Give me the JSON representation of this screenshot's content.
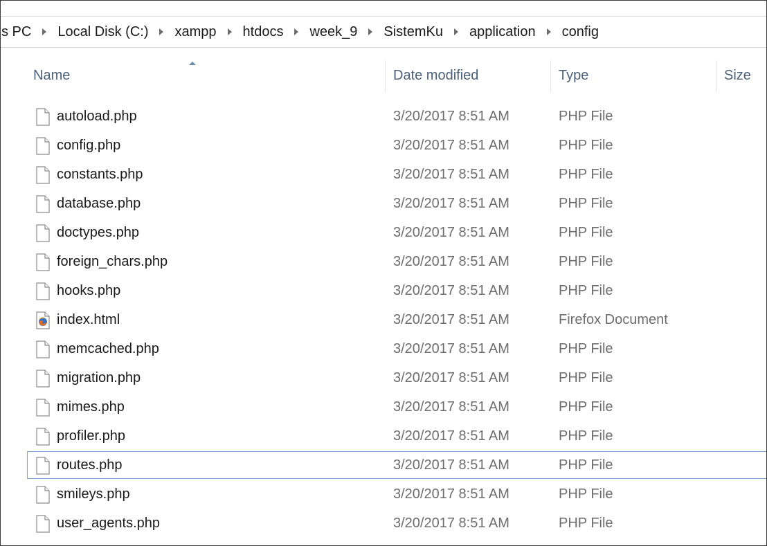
{
  "breadcrumb": [
    "s PC",
    "Local Disk (C:)",
    "xampp",
    "htdocs",
    "week_9",
    "SistemKu",
    "application",
    "config"
  ],
  "columns": {
    "name": "Name",
    "date_modified": "Date modified",
    "type": "Type",
    "size": "Size"
  },
  "files": [
    {
      "name": "autoload.php",
      "date": "3/20/2017 8:51 AM",
      "type": "PHP File",
      "icon": "blank-file-icon"
    },
    {
      "name": "config.php",
      "date": "3/20/2017 8:51 AM",
      "type": "PHP File",
      "icon": "blank-file-icon"
    },
    {
      "name": "constants.php",
      "date": "3/20/2017 8:51 AM",
      "type": "PHP File",
      "icon": "blank-file-icon"
    },
    {
      "name": "database.php",
      "date": "3/20/2017 8:51 AM",
      "type": "PHP File",
      "icon": "blank-file-icon"
    },
    {
      "name": "doctypes.php",
      "date": "3/20/2017 8:51 AM",
      "type": "PHP File",
      "icon": "blank-file-icon"
    },
    {
      "name": "foreign_chars.php",
      "date": "3/20/2017 8:51 AM",
      "type": "PHP File",
      "icon": "blank-file-icon"
    },
    {
      "name": "hooks.php",
      "date": "3/20/2017 8:51 AM",
      "type": "PHP File",
      "icon": "blank-file-icon"
    },
    {
      "name": "index.html",
      "date": "3/20/2017 8:51 AM",
      "type": "Firefox Document",
      "icon": "firefox-icon"
    },
    {
      "name": "memcached.php",
      "date": "3/20/2017 8:51 AM",
      "type": "PHP File",
      "icon": "blank-file-icon"
    },
    {
      "name": "migration.php",
      "date": "3/20/2017 8:51 AM",
      "type": "PHP File",
      "icon": "blank-file-icon"
    },
    {
      "name": "mimes.php",
      "date": "3/20/2017 8:51 AM",
      "type": "PHP File",
      "icon": "blank-file-icon"
    },
    {
      "name": "profiler.php",
      "date": "3/20/2017 8:51 AM",
      "type": "PHP File",
      "icon": "blank-file-icon"
    },
    {
      "name": "routes.php",
      "date": "3/20/2017 8:51 AM",
      "type": "PHP File",
      "icon": "blank-file-icon",
      "focused": true
    },
    {
      "name": "smileys.php",
      "date": "3/20/2017 8:51 AM",
      "type": "PHP File",
      "icon": "blank-file-icon"
    },
    {
      "name": "user_agents.php",
      "date": "3/20/2017 8:51 AM",
      "type": "PHP File",
      "icon": "blank-file-icon"
    }
  ],
  "colors": {
    "header_text": "#4c607a",
    "focus_border": "#7aa7d6",
    "secondary_text": "#6d6d6d"
  }
}
